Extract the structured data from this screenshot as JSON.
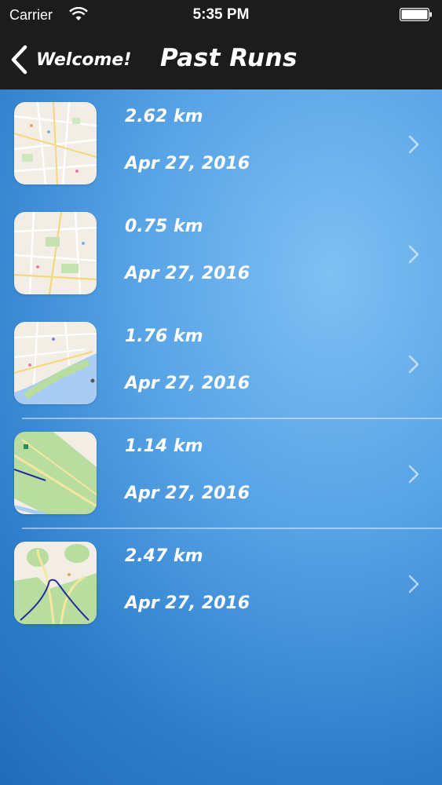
{
  "status_bar": {
    "carrier": "Carrier",
    "time": "5:35 PM",
    "wifi_icon": "wifi-icon",
    "battery_icon": "battery-icon"
  },
  "nav": {
    "back_label": "Welcome!",
    "back_icon": "chevron-left-icon",
    "title": "Past Runs"
  },
  "runs": [
    {
      "distance": "2.62 km",
      "date": "Apr 27, 2016",
      "map": "city-map-thumbnail"
    },
    {
      "distance": "0.75 km",
      "date": "Apr 27, 2016",
      "map": "city-park-map-thumbnail"
    },
    {
      "distance": "1.76 km",
      "date": "Apr 27, 2016",
      "map": "coast-map-thumbnail"
    },
    {
      "distance": "1.14 km",
      "date": "Apr 27, 2016",
      "map": "park-route-map-thumbnail"
    },
    {
      "distance": "2.47 km",
      "date": "Apr 27, 2016",
      "map": "park-route-map-thumbnail"
    }
  ],
  "colors": {
    "bar_background": "#1c1c1c",
    "text": "#ffffff",
    "background_gradient": [
      "#7fc0f3",
      "#58a4e6",
      "#2d7dcb",
      "#1f68b5"
    ]
  }
}
